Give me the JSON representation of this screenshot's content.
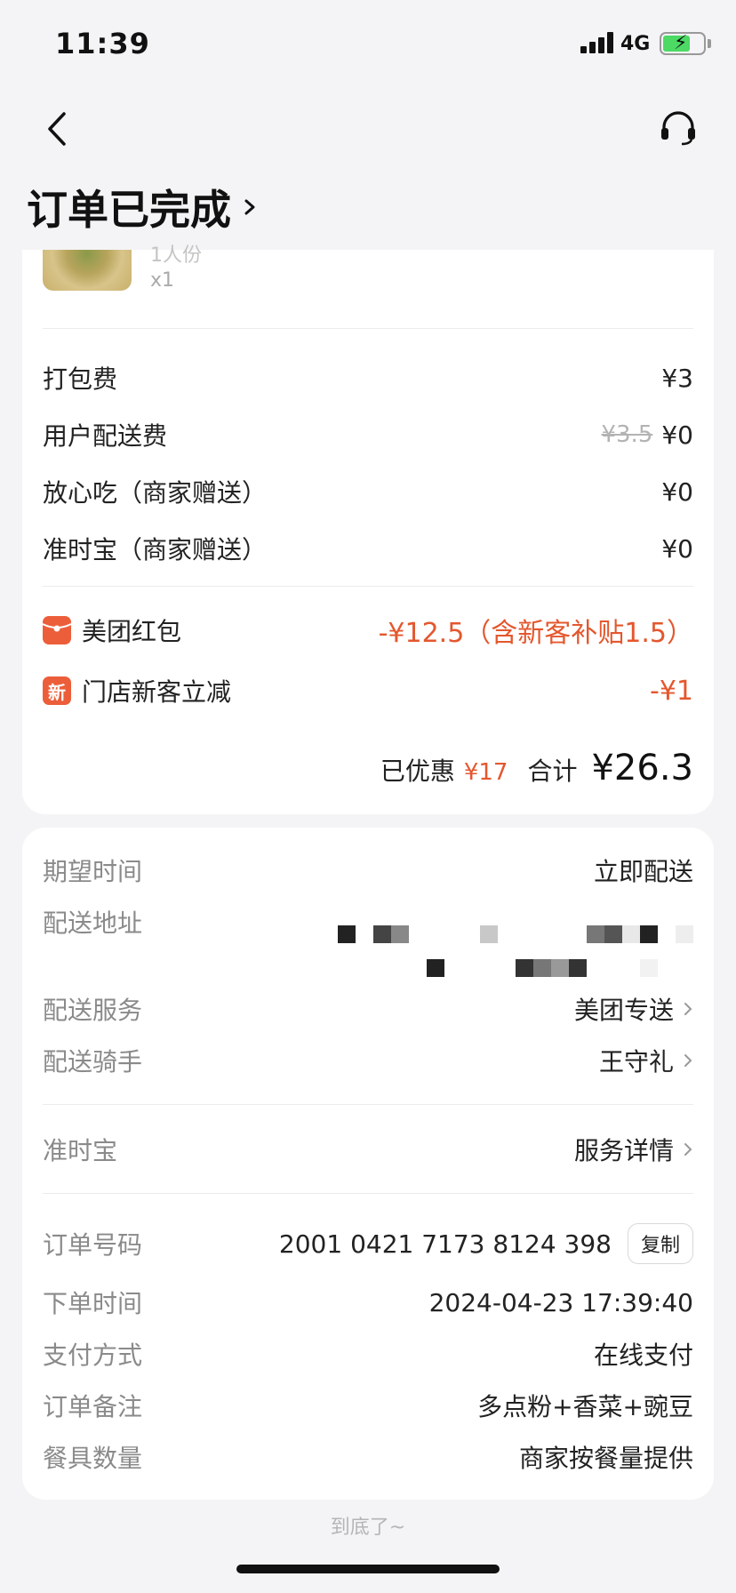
{
  "status": {
    "time": "11:39",
    "network": "4G"
  },
  "nav": {
    "title": "订单已完成"
  },
  "food": {
    "spec": "1人份",
    "qty": "x1"
  },
  "fees": [
    {
      "label": "打包费",
      "value": "¥3",
      "original": ""
    },
    {
      "label": "用户配送费",
      "value": "¥0",
      "original": "¥3.5"
    },
    {
      "label": "放心吃（商家赠送）",
      "value": "¥0",
      "original": ""
    },
    {
      "label": "准时宝（商家赠送）",
      "value": "¥0",
      "original": ""
    }
  ],
  "promos": [
    {
      "label": "美团红包",
      "value": "-¥12.5（含新客补贴1.5）",
      "icon": "red-packet-icon"
    },
    {
      "label": "门店新客立减",
      "value": "-¥1",
      "icon": "new-customer-icon",
      "icon_text": "新"
    }
  ],
  "summary": {
    "saved_label": "已优惠",
    "saved_value": "¥17",
    "total_label": "合计",
    "total_value": "¥26.3"
  },
  "delivery": [
    {
      "label": "期望时间",
      "value": "立即配送"
    },
    {
      "label": "配送地址",
      "value": ""
    },
    {
      "label": "配送服务",
      "value": "美团专送"
    },
    {
      "label": "配送骑手",
      "value": "王守礼"
    }
  ],
  "guarantee": {
    "label": "准时宝",
    "value": "服务详情"
  },
  "order": {
    "number_label": "订单号码",
    "number_value": "2001 0421 7173 8124 398",
    "copy_label": "复制",
    "time_label": "下单时间",
    "time_value": "2024-04-23 17:39:40",
    "pay_label": "支付方式",
    "pay_value": "在线支付",
    "note_label": "订单备注",
    "note_value": "多点粉+香菜+豌豆",
    "tableware_label": "餐具数量",
    "tableware_value": "商家按餐量提供"
  },
  "footer": {
    "end_text": "到底了~"
  },
  "colors": {
    "accent": "#e4572e",
    "background": "#f4f4f6"
  }
}
